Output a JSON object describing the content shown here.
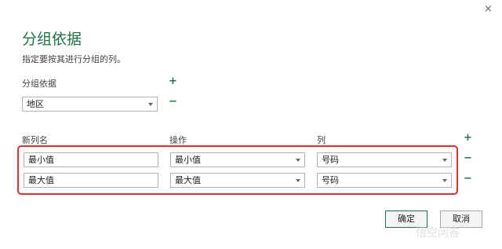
{
  "dialog": {
    "close_glyph": "×",
    "title": "分组依据",
    "description": "指定要按其进行分组的列。"
  },
  "group_by": {
    "label": "分组依据",
    "add_glyph": "+",
    "remove_glyph": "−",
    "selected": "地区"
  },
  "aggregations": {
    "headers": {
      "new_column": "新列名",
      "operation": "操作",
      "column": "列"
    },
    "add_glyph": "+",
    "rows": [
      {
        "name": "最小值",
        "operation": "最小值",
        "column": "号码",
        "remove_glyph": "−"
      },
      {
        "name": "最大值",
        "operation": "最大值",
        "column": "号码",
        "remove_glyph": "−"
      }
    ]
  },
  "footer": {
    "ok_label": "确定",
    "cancel_label": "取消"
  },
  "watermark": {
    "text": "悟空问答"
  },
  "colors": {
    "accent": "#217346",
    "highlight": "#d93030"
  }
}
